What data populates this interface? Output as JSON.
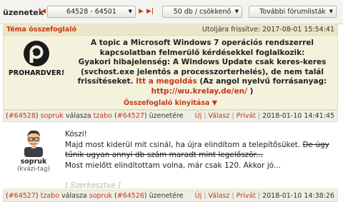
{
  "nav": {
    "title": "üzenetek",
    "range_value": "64528 - 64501",
    "per_page_value": "50 db / csökkenő",
    "more_label": "További fórumlisták"
  },
  "summary": {
    "header_title": "Téma összefoglaló",
    "updated": "Utoljára frissítve: 2017-08-01 15:54:41",
    "logo_text": "PROHARDVER!",
    "line1": "A topic a Microsoft Windows 7 operációs rendszerrel kapcsolatban felmerülő kérdésekkel foglalkozik:",
    "line2_a": "Gyakori hibajelenség: A Windows Update csak keres-keres (svchost.exe jelentős a processzorterhelés), de nem talál frissítéseket.",
    "line2_link": "Itt a megoldás",
    "line2_b": "(Az angol nyelvű forrásanyag:",
    "line2_url": "http://wu.krelay.de/en/",
    "line2_c": ")",
    "expand_label": "Összefoglaló kinyitása ▼"
  },
  "posts": [
    {
      "num": "#64528",
      "author": "sopruk",
      "reply_word": "válasza",
      "reply_to": "tzabo",
      "reply_num": "#64527",
      "msg_word": "üzenetére",
      "actions": [
        "Új",
        "Válasz",
        "Privát"
      ],
      "datetime": "2018-01-10 14:41:45",
      "user_role": "(kvázi-tag)",
      "lines": {
        "l1": "Köszi!",
        "l2_a": "Majd most kiderül mit csinál, ha újra elindítom a telepítősüket.",
        "l2_strike": "De úgy tűnik ugyan annyi db szám maradt mint legelőször...",
        "l3": "Most mielőtt elindítottam volna, már csak 120. Akkor jó...",
        "edited": "[ Szerkesztve ]"
      }
    },
    {
      "num": "#64527",
      "author": "tzabo",
      "reply_word": "válasza",
      "reply_to": "sopruk",
      "reply_num": "#64526",
      "msg_word": "üzenetére",
      "actions": [
        "Új",
        "Válasz",
        "Privát"
      ],
      "datetime": "2018-01-10 14:38:26"
    }
  ],
  "colors": {
    "accent": "#c5381a",
    "summary_bg": "#f4f1dd",
    "header_bg": "#f0eee4"
  }
}
